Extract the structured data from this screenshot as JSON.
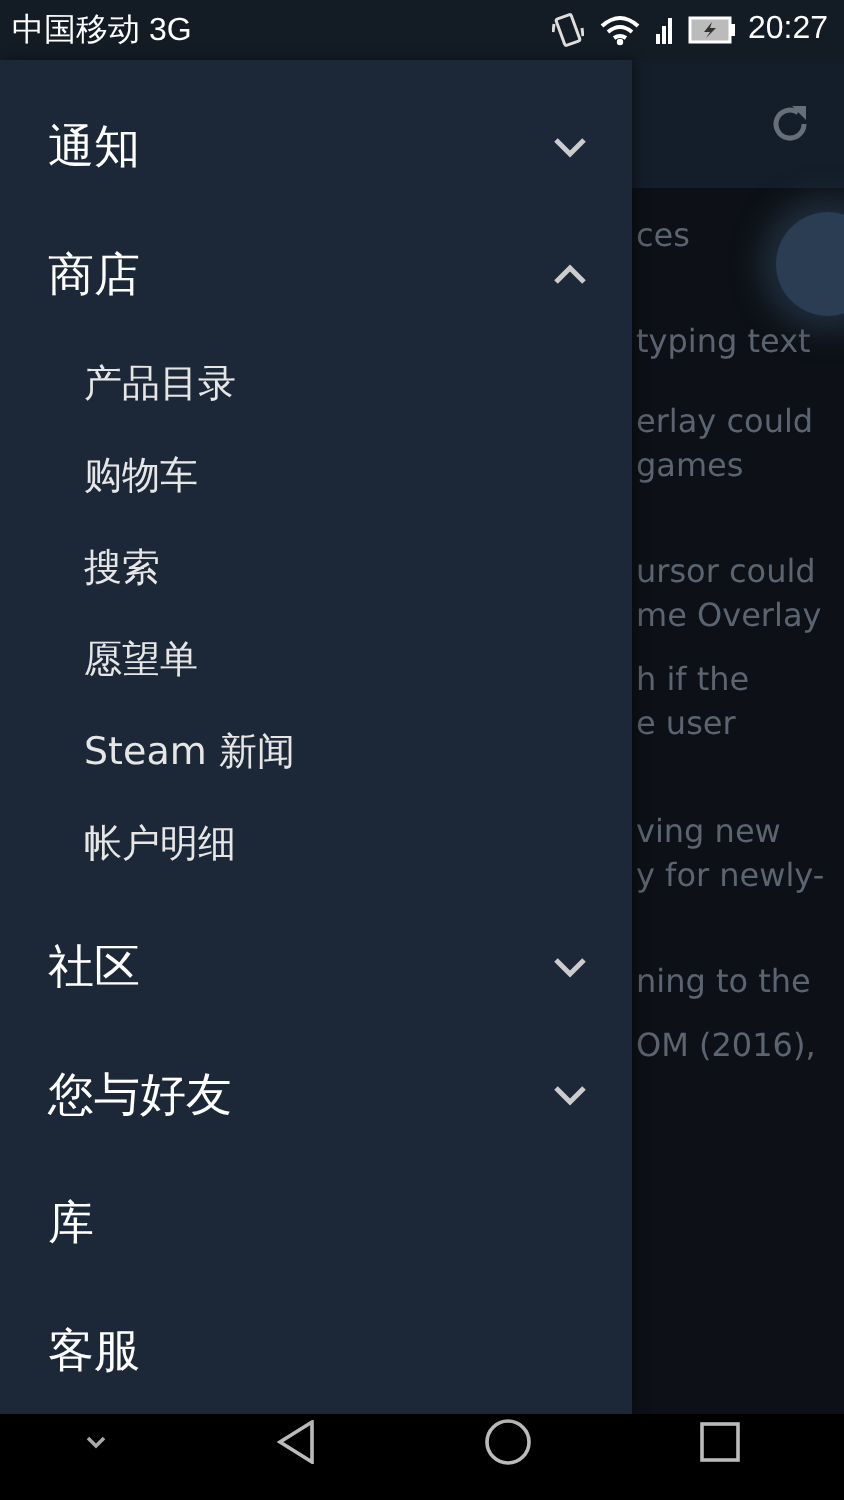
{
  "status_bar": {
    "carrier": "中国移动 3G",
    "time": "20:27"
  },
  "drawer": {
    "items": [
      {
        "label": "通知",
        "expanded": false
      },
      {
        "label": "商店",
        "expanded": true,
        "children": [
          {
            "label": "产品目录"
          },
          {
            "label": "购物车"
          },
          {
            "label": "搜索"
          },
          {
            "label": "愿望单"
          },
          {
            "label": "Steam 新闻"
          },
          {
            "label": "帐户明细"
          }
        ]
      },
      {
        "label": "社区",
        "expanded": false
      },
      {
        "label": "您与好友",
        "expanded": false
      },
      {
        "label": "库"
      },
      {
        "label": "客服"
      }
    ]
  },
  "background_text": [
    [
      "ces"
    ],
    [
      "typing text"
    ],
    [
      "erlay could",
      "games"
    ],
    [
      "ursor could",
      "me Overlay"
    ],
    [
      "h if the",
      "e user"
    ],
    [
      "ving new",
      "y for newly-"
    ],
    [
      "ning to the"
    ],
    [
      "OM (2016),"
    ]
  ]
}
